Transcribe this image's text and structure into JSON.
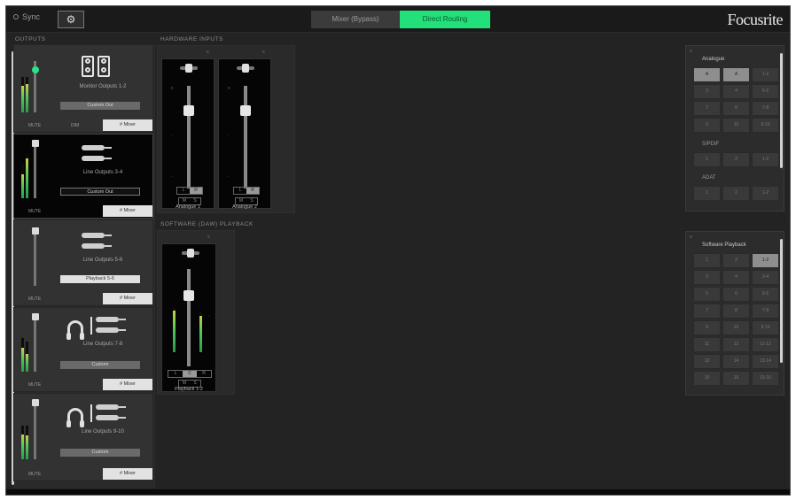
{
  "topbar": {
    "sync_label": "Sync",
    "settings_icon": "gear-icon",
    "tabs": [
      {
        "label": "Mixer (Bypass)",
        "active": false
      },
      {
        "label": "Direct Routing",
        "active": true
      }
    ],
    "logo": "Focusrite"
  },
  "colors": {
    "accent": "#22e07a",
    "background": "#232323"
  },
  "sections": {
    "outputs": "OUTPUTS",
    "hardware_inputs": "HARDWARE INPUTS",
    "software_playback": "SOFTWARE (DAW) PLAYBACK"
  },
  "outputs": [
    {
      "label": "Monitor Outputs 1-2",
      "name": "Custom Out",
      "mute": "MUTE",
      "dim": "DIM",
      "button": "# Mixer",
      "icon": "speaker-icon"
    },
    {
      "label": "Line Outputs 3-4",
      "name": "Custom Out",
      "mute": "MUTE",
      "button": "# Mixer",
      "icon": "line-out-icon"
    },
    {
      "label": "Line Outputs 5-6",
      "name": "Playback 5-6",
      "mute": "MUTE",
      "button": "# Mixer",
      "icon": "line-out-icon"
    },
    {
      "label": "Line Outputs 7-8",
      "name": "Custom",
      "mute": "MUTE",
      "button": "# Mixer",
      "icon": "headphone-icon"
    },
    {
      "label": "Line Outputs 9-10",
      "name": "Custom",
      "mute": "MUTE",
      "button": "# Mixer",
      "icon": "headphone-icon"
    }
  ],
  "hardware_strips": [
    {
      "label": "Analogue 1",
      "seg": [
        "L",
        "R"
      ],
      "btns": [
        "M",
        "S"
      ],
      "corner": "≡"
    },
    {
      "label": "Analogue 2",
      "seg": [
        "L",
        "R"
      ],
      "btns": [
        "M",
        "S"
      ],
      "corner": "≡"
    }
  ],
  "playback_strips": [
    {
      "label": "Playback 1-2",
      "seg": [
        "L",
        "C",
        "R"
      ],
      "btns": [
        "M",
        "S"
      ],
      "corner": "≡"
    }
  ],
  "right_panels": [
    {
      "title": "Analogue",
      "subtitles": [
        "S/PDIF",
        "ADAT"
      ],
      "cells": [
        "A",
        "A",
        "1-2",
        "3",
        "4",
        "5-6",
        "7",
        "8",
        "7-8",
        "9",
        "10",
        "9-10"
      ],
      "active_cells": [
        0,
        1
      ],
      "cells2": [
        "1",
        "2",
        "1-2"
      ],
      "cells3": [
        "1",
        "2",
        "1-2"
      ],
      "corner": "≡"
    },
    {
      "title": "Software Playback",
      "cells": [
        "1",
        "2",
        "1-2",
        "3",
        "4",
        "3-4",
        "5",
        "6",
        "5-6",
        "7",
        "8",
        "7-8",
        "9",
        "10",
        "9-10",
        "11",
        "12",
        "11-12",
        "13",
        "14",
        "13-14",
        "15",
        "16",
        "15-16"
      ],
      "active_cells": [
        2
      ],
      "corner": "≡"
    }
  ]
}
